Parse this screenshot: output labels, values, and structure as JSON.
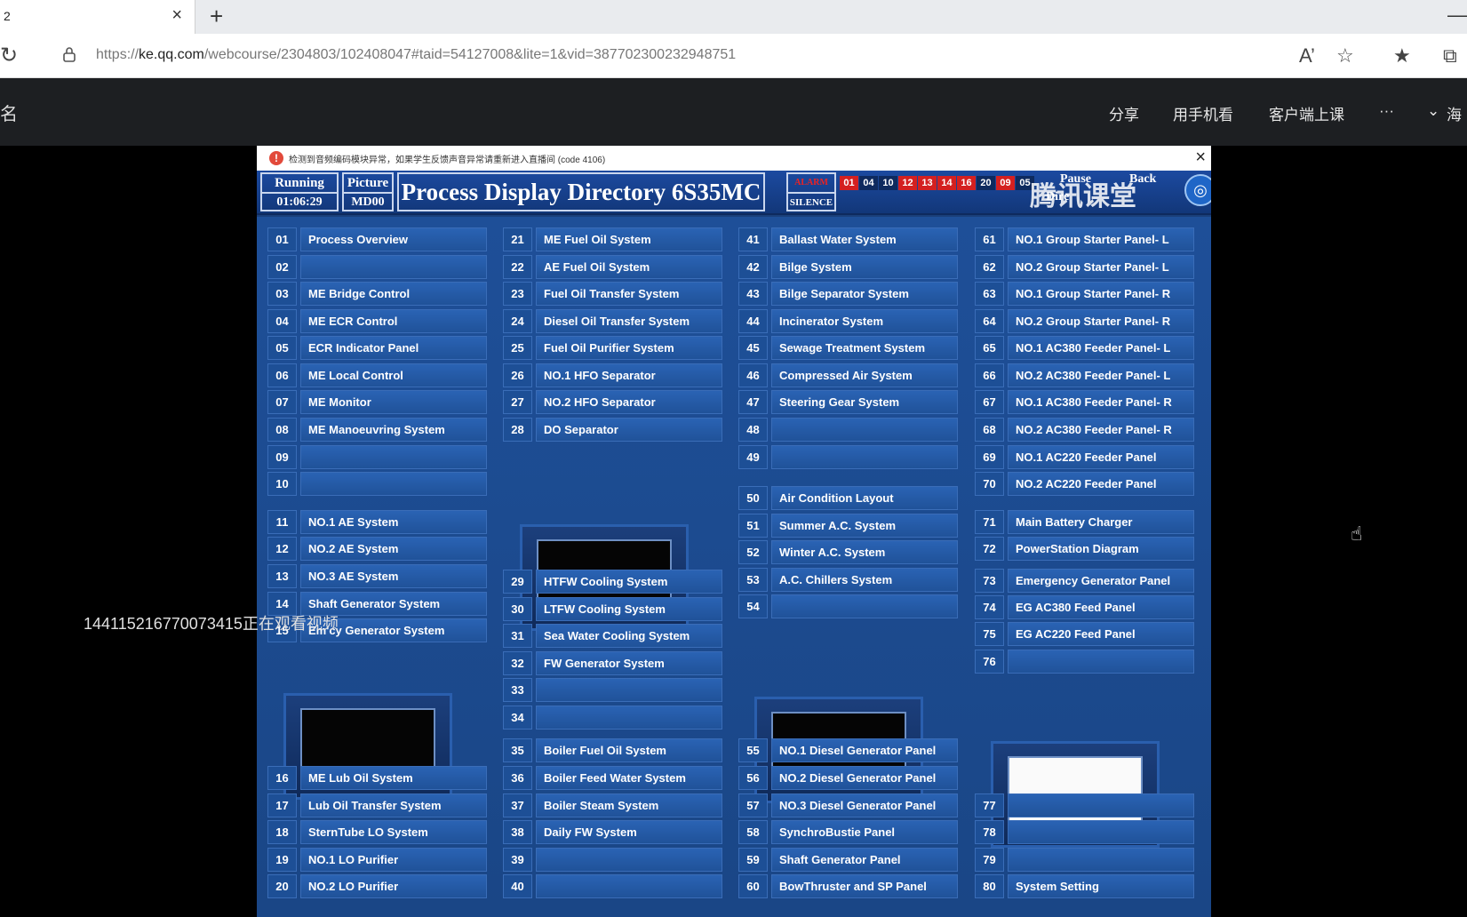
{
  "browser": {
    "tab_title": "2",
    "tab_close": "×",
    "new_tab": "+",
    "minimize": "—",
    "url_prefix": "https://",
    "url_host": "ke.qq.com",
    "url_path": "/webcourse/2304803/102408047#taid=54127008&lite=1&vid=387702300232948751"
  },
  "site": {
    "left_char": "名",
    "nav": [
      "分享",
      "用手机看",
      "客户端上课",
      "···",
      "海"
    ]
  },
  "notice": {
    "text": "检测到音频编码模块异常，如果学生反馈声音异常请重新进入直播间 (code 4106)"
  },
  "header": {
    "running_label": "Running",
    "running_time": "01:06:29",
    "picture_label": "Picture",
    "picture_id": "MD00",
    "title": "Process Display Directory 6S35MC",
    "alarm_label": "ALARM",
    "silence_label": "SILENCE",
    "groups": [
      {
        "id": "01",
        "color": "#d42020"
      },
      {
        "id": "04",
        "color": "#0e2a5e"
      },
      {
        "id": "10",
        "color": "#0e2a5e"
      },
      {
        "id": "12",
        "color": "#d42020"
      },
      {
        "id": "13",
        "color": "#d42020"
      },
      {
        "id": "14",
        "color": "#d42020"
      },
      {
        "id": "16",
        "color": "#d42020"
      },
      {
        "id": "20",
        "color": "#0e2a5e"
      },
      {
        "id": "09",
        "color": "#d42020"
      },
      {
        "id": "05",
        "color": "#0e2a5e"
      }
    ],
    "pause_label": "Pause",
    "back_label": "Back",
    "watermark": "腾讯课堂",
    "dire_label": "Dire"
  },
  "overlay": "14411521677007341​5正在观看视频",
  "col1": [
    {
      "n": "01",
      "label": "Process Overview"
    },
    {
      "n": "02",
      "label": ""
    },
    {
      "n": "03",
      "label": "ME Bridge Control"
    },
    {
      "n": "04",
      "label": "ME ECR Control"
    },
    {
      "n": "05",
      "label": "ECR Indicator Panel"
    },
    {
      "n": "06",
      "label": "ME Local Control"
    },
    {
      "n": "07",
      "label": "ME Monitor"
    },
    {
      "n": "08",
      "label": "ME Manoeuvring System"
    },
    {
      "n": "09",
      "label": ""
    },
    {
      "n": "10",
      "label": ""
    },
    {
      "n": "11",
      "label": "NO.1 AE System"
    },
    {
      "n": "12",
      "label": "NO.2 AE System"
    },
    {
      "n": "13",
      "label": "NO.3 AE System"
    },
    {
      "n": "14",
      "label": "Shaft Generator System"
    },
    {
      "n": "15",
      "label": "Em'cy Generator System"
    },
    {
      "n": "16",
      "label": "ME Lub Oil System"
    },
    {
      "n": "17",
      "label": "Lub Oil Transfer System"
    },
    {
      "n": "18",
      "label": "SternTube LO System"
    },
    {
      "n": "19",
      "label": "NO.1 LO Purifier"
    },
    {
      "n": "20",
      "label": "NO.2 LO Purifier"
    }
  ],
  "col2": [
    {
      "n": "21",
      "label": "ME Fuel Oil System"
    },
    {
      "n": "22",
      "label": "AE Fuel Oil System"
    },
    {
      "n": "23",
      "label": "Fuel Oil Transfer System"
    },
    {
      "n": "24",
      "label": "Diesel Oil Transfer System"
    },
    {
      "n": "25",
      "label": "Fuel Oil Purifier System"
    },
    {
      "n": "26",
      "label": "NO.1 HFO Separator"
    },
    {
      "n": "27",
      "label": "NO.2 HFO Separator"
    },
    {
      "n": "28",
      "label": "DO Separator"
    },
    {
      "n": "29",
      "label": "HTFW Cooling System"
    },
    {
      "n": "30",
      "label": "LTFW Cooling System"
    },
    {
      "n": "31",
      "label": "Sea Water Cooling System"
    },
    {
      "n": "32",
      "label": "FW Generator System"
    },
    {
      "n": "33",
      "label": ""
    },
    {
      "n": "34",
      "label": ""
    },
    {
      "n": "35",
      "label": "Boiler Fuel Oil System"
    },
    {
      "n": "36",
      "label": "Boiler Feed Water System"
    },
    {
      "n": "37",
      "label": "Boiler Steam System"
    },
    {
      "n": "38",
      "label": "Daily FW System"
    },
    {
      "n": "39",
      "label": ""
    },
    {
      "n": "40",
      "label": ""
    }
  ],
  "col3": [
    {
      "n": "41",
      "label": "Ballast Water System"
    },
    {
      "n": "42",
      "label": "Bilge System"
    },
    {
      "n": "43",
      "label": "Bilge Separator System"
    },
    {
      "n": "44",
      "label": "Incinerator System"
    },
    {
      "n": "45",
      "label": "Sewage Treatment System"
    },
    {
      "n": "46",
      "label": "Compressed Air System"
    },
    {
      "n": "47",
      "label": "Steering Gear System"
    },
    {
      "n": "48",
      "label": ""
    },
    {
      "n": "49",
      "label": ""
    },
    {
      "n": "50",
      "label": "Air Condition Layout"
    },
    {
      "n": "51",
      "label": "Summer A.C. System"
    },
    {
      "n": "52",
      "label": "Winter A.C. System"
    },
    {
      "n": "53",
      "label": "A.C. Chillers System"
    },
    {
      "n": "54",
      "label": ""
    },
    {
      "n": "55",
      "label": "NO.1 Diesel Generator Panel"
    },
    {
      "n": "56",
      "label": "NO.2 Diesel Generator Panel"
    },
    {
      "n": "57",
      "label": "NO.3 Diesel Generator Panel"
    },
    {
      "n": "58",
      "label": "SynchroBustie Panel"
    },
    {
      "n": "59",
      "label": "Shaft Generator Panel"
    },
    {
      "n": "60",
      "label": "BowThruster and SP Panel"
    }
  ],
  "col4": [
    {
      "n": "61",
      "label": "NO.1 Group Starter Panel- L"
    },
    {
      "n": "62",
      "label": "NO.2 Group Starter Panel- L"
    },
    {
      "n": "63",
      "label": "NO.1 Group Starter Panel- R"
    },
    {
      "n": "64",
      "label": "NO.2 Group Starter Panel- R"
    },
    {
      "n": "65",
      "label": "NO.1 AC380 Feeder Panel- L"
    },
    {
      "n": "66",
      "label": "NO.2 AC380 Feeder Panel- L"
    },
    {
      "n": "67",
      "label": "NO.1 AC380 Feeder Panel- R"
    },
    {
      "n": "68",
      "label": "NO.2 AC380 Feeder Panel- R"
    },
    {
      "n": "69",
      "label": "NO.1 AC220 Feeder Panel"
    },
    {
      "n": "70",
      "label": "NO.2 AC220 Feeder Panel"
    },
    {
      "n": "71",
      "label": "Main Battery Charger"
    },
    {
      "n": "72",
      "label": "PowerStation Diagram"
    },
    {
      "n": "73",
      "label": "Emergency Generator Panel"
    },
    {
      "n": "74",
      "label": "EG AC380 Feed Panel"
    },
    {
      "n": "75",
      "label": "EG AC220 Feed Panel"
    },
    {
      "n": "76",
      "label": ""
    },
    {
      "n": "77",
      "label": ""
    },
    {
      "n": "78",
      "label": ""
    },
    {
      "n": "79",
      "label": ""
    },
    {
      "n": "80",
      "label": "System Setting"
    }
  ]
}
